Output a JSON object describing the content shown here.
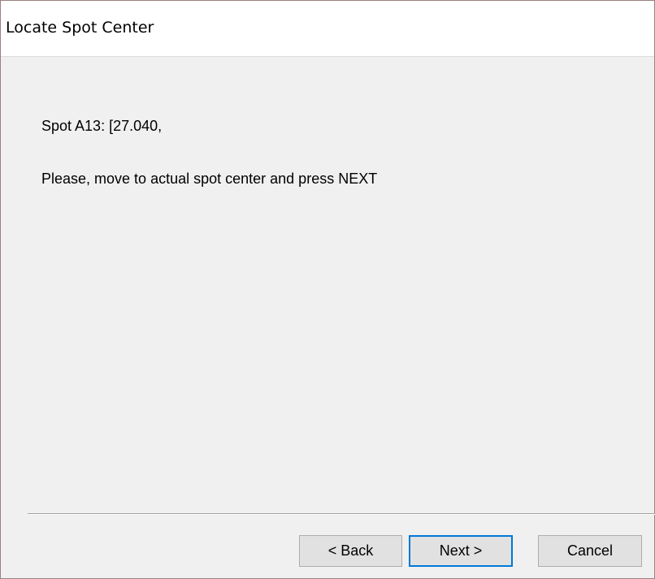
{
  "window": {
    "title": "Locate Spot Center"
  },
  "content": {
    "spot_label": "Spot A13: [27.040,",
    "instruction": "Please, move to actual spot center and press NEXT"
  },
  "buttons": {
    "back_label": "< Back",
    "next_label": "Next >",
    "cancel_label": "Cancel"
  },
  "colors": {
    "background": "#f0f0f0",
    "titlebar": "#ffffff",
    "default_button_border": "#0078d7"
  }
}
